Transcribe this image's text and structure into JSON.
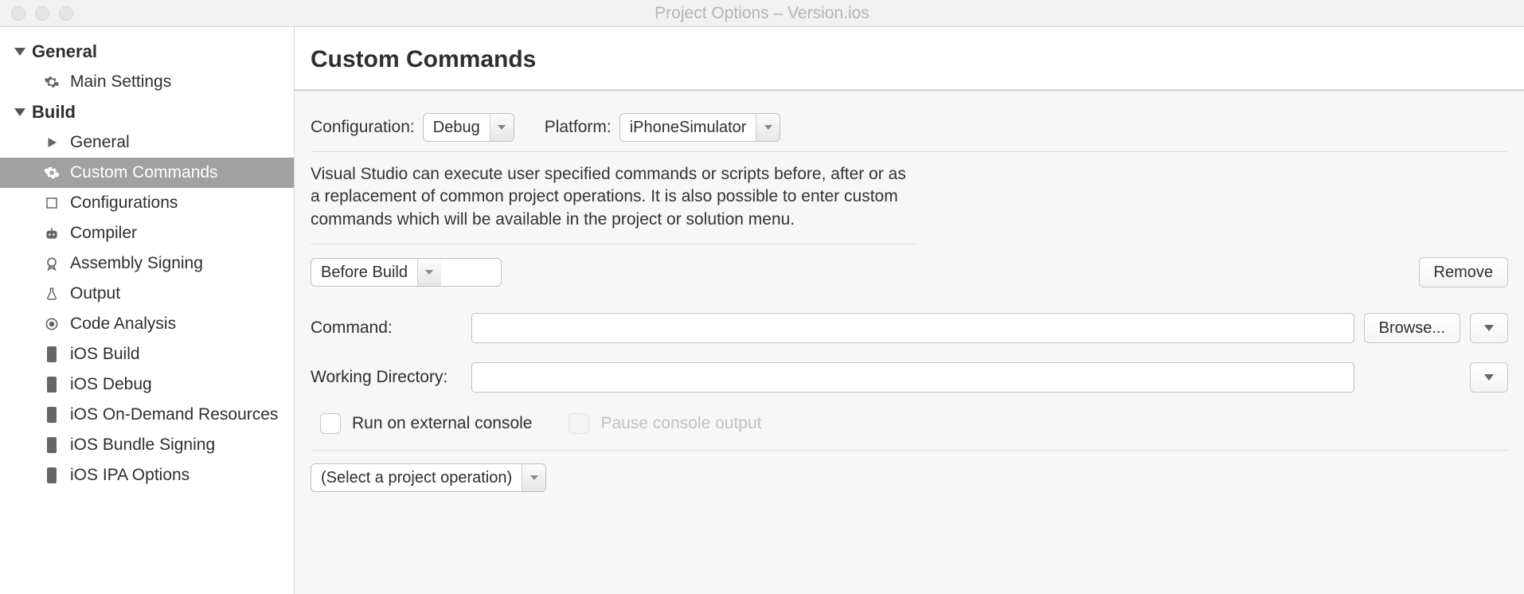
{
  "window_title": "Project Options – Version.ios",
  "sidebar": {
    "groups": [
      {
        "label": "General",
        "items": [
          {
            "label": "Main Settings",
            "icon": "gear"
          }
        ]
      },
      {
        "label": "Build",
        "items": [
          {
            "label": "General",
            "icon": "play"
          },
          {
            "label": "Custom Commands",
            "icon": "gear",
            "selected": true
          },
          {
            "label": "Configurations",
            "icon": "box"
          },
          {
            "label": "Compiler",
            "icon": "robot"
          },
          {
            "label": "Assembly Signing",
            "icon": "badge"
          },
          {
            "label": "Output",
            "icon": "flask"
          },
          {
            "label": "Code Analysis",
            "icon": "target"
          },
          {
            "label": "iOS Build",
            "icon": "phone"
          },
          {
            "label": "iOS Debug",
            "icon": "phone"
          },
          {
            "label": "iOS On-Demand Resources",
            "icon": "phone"
          },
          {
            "label": "iOS Bundle Signing",
            "icon": "phone"
          },
          {
            "label": "iOS IPA Options",
            "icon": "phone"
          }
        ]
      }
    ]
  },
  "page": {
    "title": "Custom Commands",
    "config_label": "Configuration:",
    "config_value": "Debug",
    "platform_label": "Platform:",
    "platform_value": "iPhoneSimulator",
    "description": "Visual Studio can execute user specified commands or scripts before, after or as a replacement of common project operations. It is also possible to enter custom commands which will be available in the project or solution menu.",
    "step_value": "Before Build",
    "remove_label": "Remove",
    "command_label": "Command:",
    "command_value": "",
    "browse_label": "Browse...",
    "working_dir_label": "Working Directory:",
    "working_dir_value": "",
    "run_ext_label": "Run on external console",
    "pause_label": "Pause console output",
    "project_op_value": "(Select a project operation)"
  }
}
